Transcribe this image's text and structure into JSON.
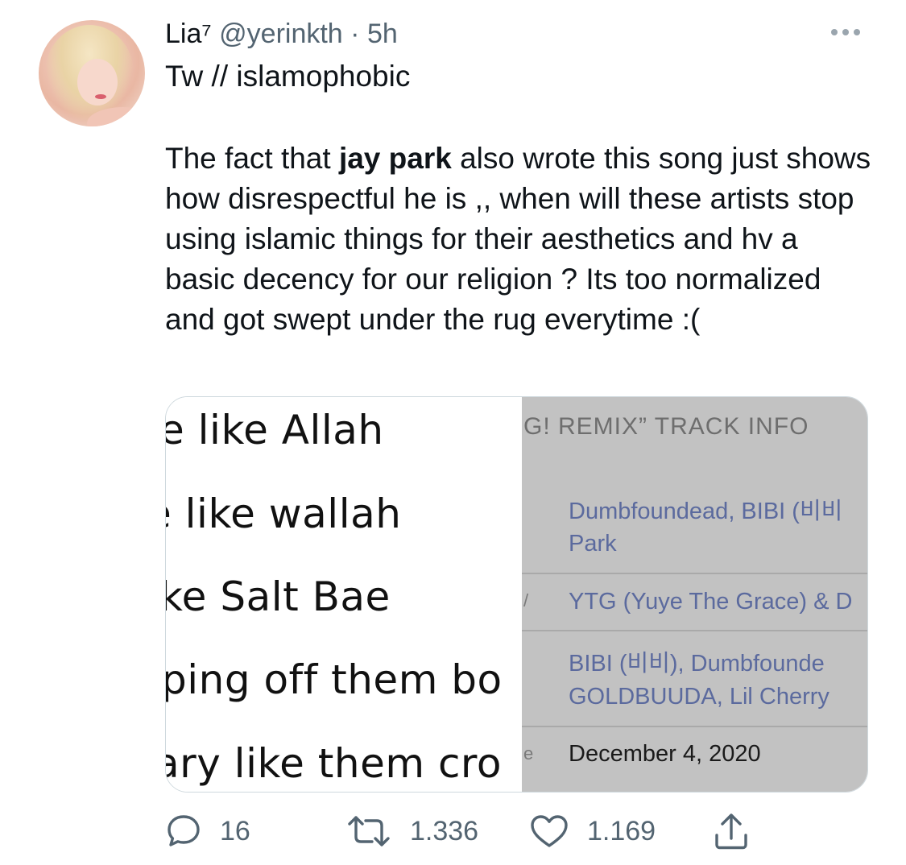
{
  "tweet": {
    "display_name": "Lia⁷",
    "handle": "@yerinkth",
    "separator": "·",
    "time": "5h",
    "trigger_warning": "Tw // islamophobic",
    "text_before_bold": "The fact that ",
    "bold_text": "jay park",
    "text_after_bold": " also wrote this song just shows how disrespectful he is ,, when will these artists stop using islamic things for their aesthetics and hv a basic decency for our religion ? Its too normalized and got swept under the rug everytime :("
  },
  "media": {
    "lyrics": [
      "e like Allah",
      "e like wallah",
      "ke Salt Bae",
      "ping off them bo",
      "ary like them cro"
    ],
    "track_info_title": "G! REMIX” TRACK INFO",
    "credits": [
      {
        "line1": "Dumbfoundead, BIBI (비비",
        "line2": "Park"
      },
      {
        "line1": "YTG (Yuye The Grace) & D"
      },
      {
        "line1": "BIBI (비비), Dumbfounde",
        "line2": "GOLDBUUDA, Lil Cherry"
      }
    ],
    "release_date": "December 4, 2020"
  },
  "actions": {
    "replies": "16",
    "retweets": "1.336",
    "likes": "1.169"
  },
  "icons": {
    "more": "more-dots-icon",
    "reply": "reply-icon",
    "retweet": "retweet-icon",
    "like": "heart-icon",
    "share": "share-icon"
  },
  "colors": {
    "text": "#0f1419",
    "secondary": "#536471",
    "credit_link": "#5b6a9e",
    "track_panel": "#c2c2c2"
  }
}
